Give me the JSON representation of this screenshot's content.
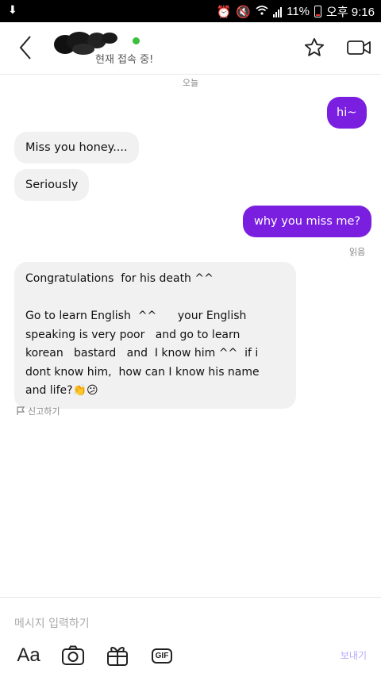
{
  "status_bar": {
    "battery_text": "11%",
    "time_text": "오후 9:16"
  },
  "header": {
    "status": "현재 접속 중!",
    "online_color": "#3cbf3c",
    "icons": [
      "back-icon",
      "star-icon",
      "video-call-icon"
    ]
  },
  "chat": {
    "date_separator": "오늘",
    "messages": [
      {
        "direction": "out",
        "text": "hi~"
      },
      {
        "direction": "in",
        "text": "Miss you honey...."
      },
      {
        "direction": "in",
        "text": "Seriously"
      },
      {
        "direction": "out",
        "text": "why you miss me?",
        "receipt": "읽음"
      },
      {
        "direction": "in",
        "text": "Congratulations  for his death ^^\n\nGo to learn English  ^^      your English\nspeaking is very poor   and go to learn\nkorean   bastard   and  I know him ^^  if i\ndont know him,  how can I know his name\nand life?👏😕"
      }
    ],
    "report_label": "신고하기",
    "outgoing_color": "#7a1fe0",
    "incoming_color": "#f1f1f1"
  },
  "composer": {
    "placeholder": "메시지 입력하기",
    "font_button": "Aa",
    "gif_label": "GIF",
    "send_label": "보내기"
  }
}
